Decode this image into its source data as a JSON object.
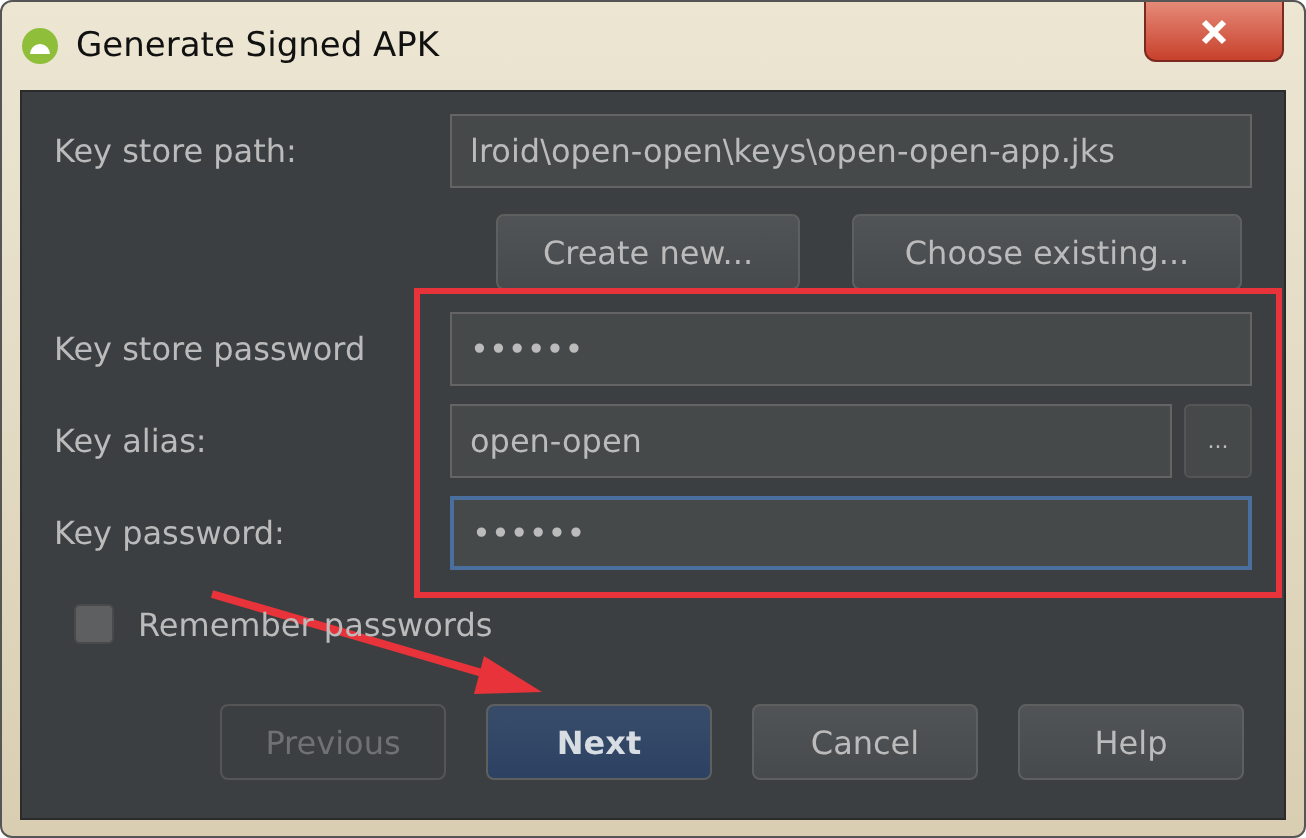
{
  "window": {
    "title": "Generate Signed APK"
  },
  "fields": [
    {
      "label": "Key store path:",
      "value": "lroid\\open-open\\keys\\open-open-app.jks",
      "focused": false
    },
    {
      "label": "Key store password",
      "value": "••••••",
      "focused": false
    },
    {
      "label": "Key alias:",
      "value": "open-open",
      "focused": false,
      "browse": "..."
    },
    {
      "label": "Key password:",
      "value": "••••••",
      "focused": true
    }
  ],
  "keystore_buttons": [
    "Create new...",
    "Choose existing..."
  ],
  "remember_passwords": {
    "label": "Remember passwords",
    "checked": false
  },
  "buttons": [
    {
      "label": "Previous",
      "disabled": true,
      "default": false
    },
    {
      "label": "Next",
      "disabled": false,
      "default": true
    },
    {
      "label": "Cancel",
      "disabled": false,
      "default": false
    },
    {
      "label": "Help",
      "disabled": false,
      "default": false
    }
  ]
}
